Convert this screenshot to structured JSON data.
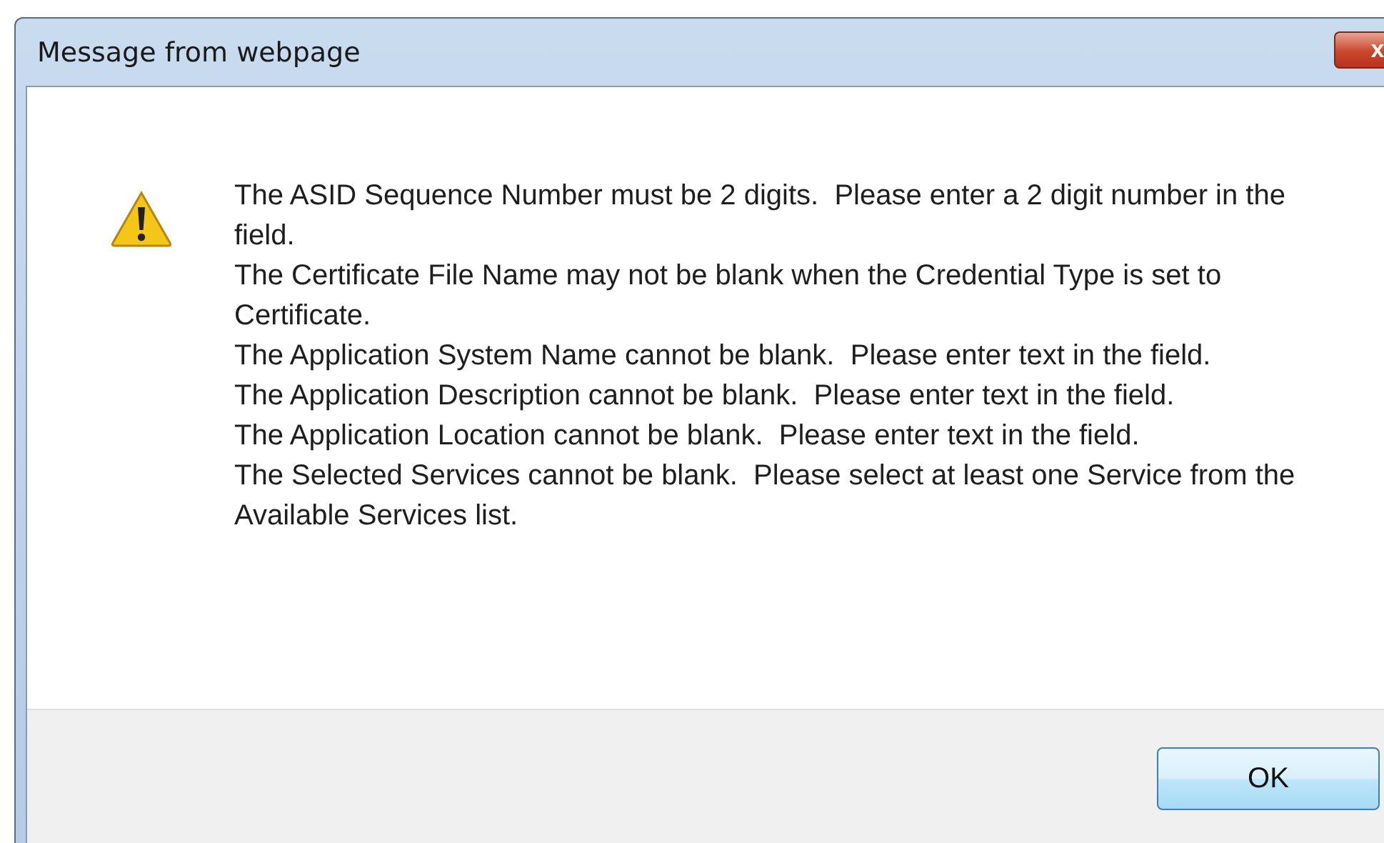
{
  "window": {
    "title": "Message from webpage",
    "close_label": "x"
  },
  "messages": [
    "The ASID Sequence Number must be 2 digits.  Please enter a 2 digit number in the field.",
    "The Certificate File Name may not be blank when the Credential Type is set to Certificate.",
    "The Application System Name cannot be blank.  Please enter text in the field.",
    "The Application Description cannot be blank.  Please enter text in the field.",
    "The Application Location cannot be blank.  Please enter text in the field.",
    "The Selected Services cannot be blank.  Please select at least one Service from the Available Services list."
  ],
  "buttons": [
    "OK"
  ]
}
